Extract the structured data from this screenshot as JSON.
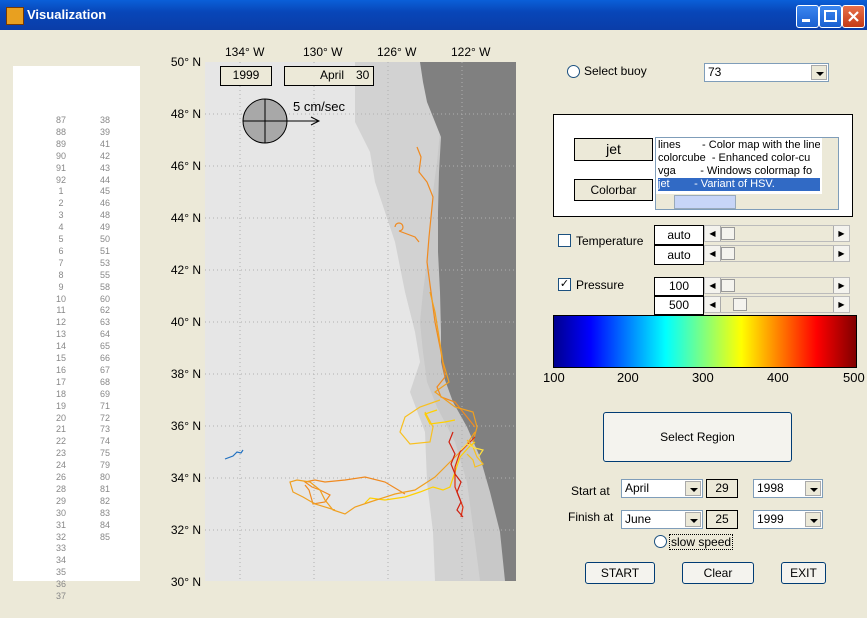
{
  "window": {
    "title": "Visualization"
  },
  "buoy_list": {
    "col1": [
      "87",
      "88",
      "89",
      "90",
      "91",
      "92",
      "1",
      "2",
      "3",
      "4",
      "5",
      "6",
      "7",
      "8",
      "9",
      "10",
      "11",
      "12",
      "13",
      "14",
      "15",
      "16",
      "17",
      "18",
      "19",
      "20",
      "21",
      "22",
      "23",
      "24",
      "26",
      "28",
      "29",
      "30",
      "31",
      "32",
      "33",
      "34",
      "35",
      "36",
      "37"
    ],
    "col2": [
      "38",
      "39",
      "41",
      "42",
      "43",
      "44",
      "45",
      "46",
      "48",
      "49",
      "50",
      "51",
      "53",
      "55",
      "58",
      "60",
      "62",
      "63",
      "64",
      "65",
      "66",
      "67",
      "68",
      "69",
      "71",
      "72",
      "73",
      "74",
      "75",
      "79",
      "80",
      "81",
      "82",
      "83",
      "84",
      "85"
    ]
  },
  "map": {
    "lon_labels": [
      "134° W",
      "130° W",
      "126° W",
      "122° W"
    ],
    "lat_labels": [
      "50° N",
      "48° N",
      "46° N",
      "44° N",
      "42° N",
      "40° N",
      "38° N",
      "36° N",
      "34° N",
      "32° N",
      "30° N"
    ],
    "year": "1999",
    "month": "April",
    "day": "30",
    "scale_label": "5 cm/sec",
    "colors": {
      "ocean": "#e6e6e6",
      "shelf": "#d2d2d2",
      "land": "#808080"
    }
  },
  "controls": {
    "select_buoy_label": "Select buoy",
    "buoy_value": "73",
    "colormap_name": "jet",
    "colorbar_button": "Colorbar",
    "colormaps": [
      {
        "name": "lines",
        "desc": "- Color map with the line"
      },
      {
        "name": "colorcube",
        "desc": "- Enhanced color-cu"
      },
      {
        "name": "vga",
        "desc": "- Windows colormap fo"
      },
      {
        "name": "jet",
        "desc": "- Variant of HSV."
      }
    ],
    "temperature": {
      "label": "Temperature",
      "checked": false,
      "min": "auto",
      "max": "auto"
    },
    "pressure": {
      "label": "Pressure",
      "checked": true,
      "check_glyph": "✓",
      "min": "100",
      "max": "500"
    },
    "colorbar_ticks": [
      "100",
      "200",
      "300",
      "400",
      "500"
    ],
    "select_region": "Select Region",
    "start_label": "Start at",
    "start_month": "April",
    "start_day": "29",
    "start_year": "1998",
    "finish_label": "Finish at",
    "finish_month": "June",
    "finish_day": "25",
    "finish_year": "1999",
    "slow_speed_label": "slow speed",
    "start_button": "START",
    "clear_button": "Clear",
    "exit_button": "EXIT"
  }
}
